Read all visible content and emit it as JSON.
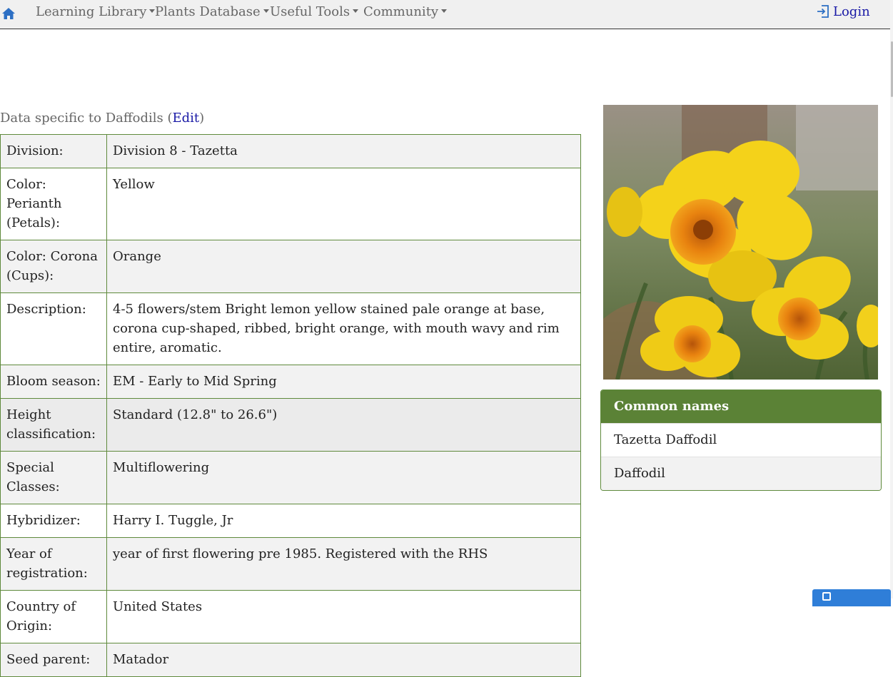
{
  "nav": {
    "items": [
      {
        "label": "Learning Library"
      },
      {
        "label": "Plants Database"
      },
      {
        "label": "Useful Tools"
      },
      {
        "label": "Community"
      }
    ],
    "login_label": "Login"
  },
  "section": {
    "prefix": "Data specific to Daffodils (",
    "edit_label": "Edit",
    "suffix": ")"
  },
  "table": {
    "rows": [
      {
        "label": "Division:",
        "value": "Division 8 - Tazetta"
      },
      {
        "label": "Color: Perianth (Petals):",
        "value": "Yellow"
      },
      {
        "label": "Color: Corona (Cups):",
        "value": "Orange"
      },
      {
        "label": "Description:",
        "value": "4-5 flowers/stem Bright lemon yellow stained pale orange at base, corona cup-shaped, ribbed, bright orange, with mouth wavy and rim entire, aromatic."
      },
      {
        "label": "Bloom season:",
        "value": "EM - Early to Mid Spring"
      },
      {
        "label": "Height classification:",
        "value": "Standard (12.8\" to 26.6\")"
      },
      {
        "label": "Special Classes:",
        "value": "Multiflowering"
      },
      {
        "label": "Hybridizer:",
        "value": "Harry I. Tuggle, Jr"
      },
      {
        "label": "Year of registration:",
        "value": "year of first flowering pre 1985. Registered with the RHS"
      },
      {
        "label": "Country of Origin:",
        "value": "United States"
      },
      {
        "label": "Seed parent:",
        "value": "Matador"
      }
    ]
  },
  "common_names": {
    "title": "Common names",
    "items": [
      "Tazetta Daffodil",
      "Daffodil"
    ]
  },
  "icons": {
    "home": "home-icon",
    "login": "login-icon",
    "caret": "caret-down-icon"
  },
  "colors": {
    "accent_green": "#5b8236",
    "link_blue": "#1a1aa6",
    "border_green": "#5f8a3c"
  }
}
